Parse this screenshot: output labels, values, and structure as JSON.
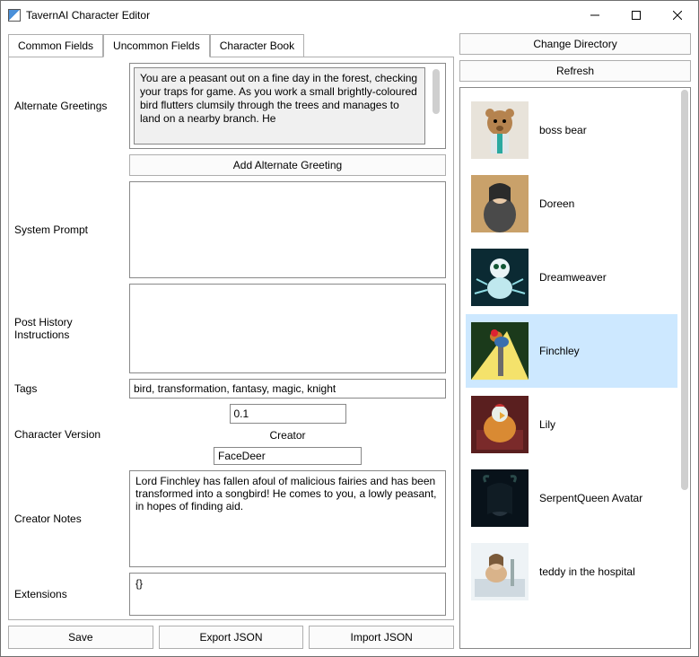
{
  "window": {
    "title": "TavernAI Character Editor"
  },
  "tabs": {
    "common": "Common Fields",
    "uncommon": "Uncommon Fields",
    "book": "Character Book"
  },
  "labels": {
    "alternate_greetings": "Alternate Greetings",
    "add_alt_greeting": "Add Alternate Greeting",
    "system_prompt": "System Prompt",
    "post_history": "Post History Instructions",
    "tags": "Tags",
    "char_version": "Character Version",
    "creator": "Creator",
    "creator_notes": "Creator Notes",
    "extensions": "Extensions"
  },
  "fields": {
    "alternate_greeting": "You are a peasant out on a fine day in the forest, checking your traps for game. As you work a small brightly-coloured bird flutters clumsily through the trees and manages to land on a nearby branch. He",
    "system_prompt": "",
    "post_history": "",
    "tags": "bird, transformation, fantasy, magic, knight",
    "char_version": "0.1",
    "creator": "FaceDeer",
    "creator_notes": "Lord Finchley has fallen afoul of malicious fairies and has been transformed into a songbird! He comes to you, a lowly peasant, in hopes of finding aid.",
    "extensions": "{}"
  },
  "buttons": {
    "save": "Save",
    "export_json": "Export JSON",
    "import_json": "Import JSON",
    "change_dir": "Change Directory",
    "refresh": "Refresh"
  },
  "characters": [
    {
      "name": "boss bear",
      "selected": false,
      "thumb": "bear"
    },
    {
      "name": "Doreen",
      "selected": false,
      "thumb": "woman1"
    },
    {
      "name": "Dreamweaver",
      "selected": false,
      "thumb": "spider"
    },
    {
      "name": "Finchley",
      "selected": true,
      "thumb": "bird"
    },
    {
      "name": "Lily",
      "selected": false,
      "thumb": "chicken"
    },
    {
      "name": "SerpentQueen Avatar",
      "selected": false,
      "thumb": "dark"
    },
    {
      "name": "teddy in the hospital",
      "selected": false,
      "thumb": "hospital"
    }
  ]
}
